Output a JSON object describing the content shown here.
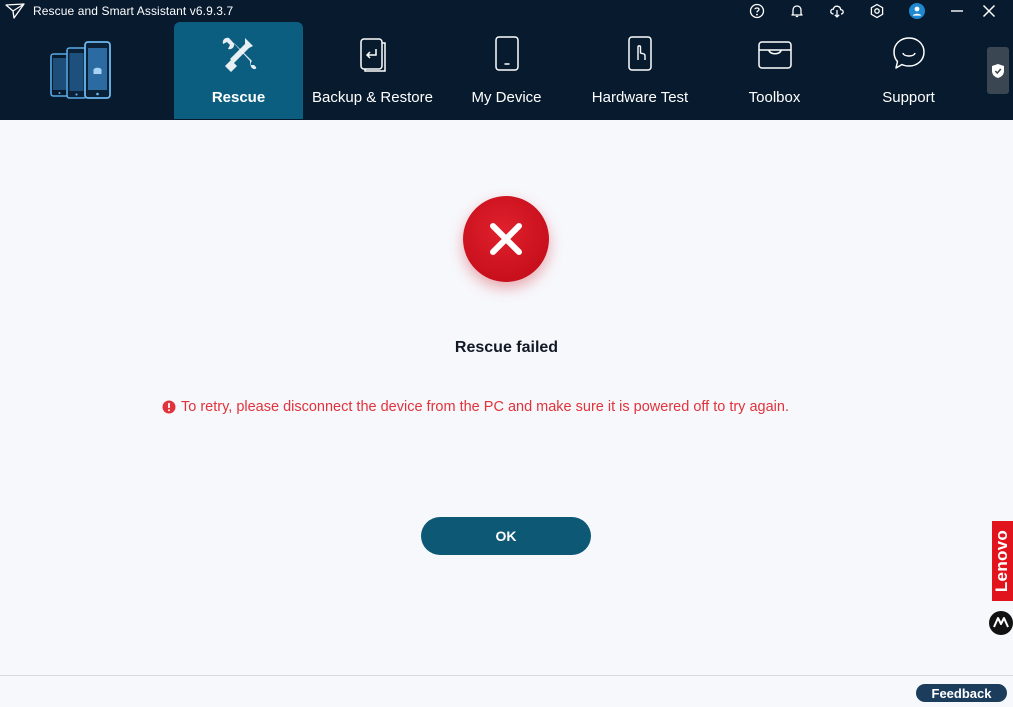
{
  "window": {
    "title": "Rescue and Smart Assistant v6.9.3.7",
    "icons": [
      "help-icon",
      "bell-icon",
      "cloud-download-icon",
      "settings-icon",
      "user-icon",
      "minimize-icon",
      "close-icon"
    ]
  },
  "nav": {
    "items": [
      {
        "label": "Rescue",
        "icon": "wrench-screwdriver-icon",
        "active": true
      },
      {
        "label": "Backup & Restore",
        "icon": "backup-restore-icon",
        "active": false
      },
      {
        "label": "My Device",
        "icon": "phone-icon",
        "active": false
      },
      {
        "label": "Hardware Test",
        "icon": "touch-phone-icon",
        "active": false
      },
      {
        "label": "Toolbox",
        "icon": "toolbox-icon",
        "active": false
      },
      {
        "label": "Support",
        "icon": "chat-bubble-icon",
        "active": false
      }
    ]
  },
  "result": {
    "status": "error",
    "title": "Rescue failed",
    "message": "To retry, please disconnect the device from the PC and make sure it is powered off to try again.",
    "ok_label": "OK"
  },
  "brand": {
    "lenovo": "Lenovo"
  },
  "footer": {
    "feedback_label": "Feedback"
  },
  "colors": {
    "header_bg": "#071a2e",
    "active_tab": "#0c5e80",
    "error_red": "#d0121e",
    "message_red": "#e0333b",
    "ok_button": "#0d5875"
  }
}
